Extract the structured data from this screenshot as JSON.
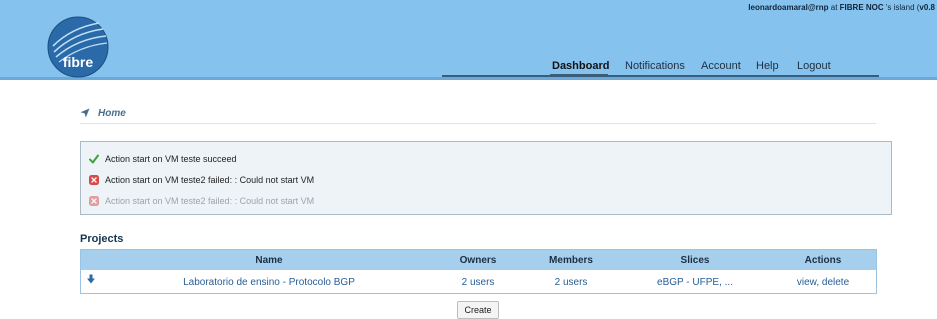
{
  "header": {
    "user": "leonardoamaral@rnp",
    "at_text": " at ",
    "island": "FIBRE NOC",
    "island_suffix": " 's island (",
    "version": "v0.8",
    "logo_text": "fibre",
    "colors": {
      "bar": "#86c2ee",
      "logo": "#2a6aa8"
    }
  },
  "nav": {
    "items": [
      {
        "label": "Dashboard",
        "active": true
      },
      {
        "label": "Notifications"
      },
      {
        "label": "Account"
      },
      {
        "label": "Help"
      },
      {
        "label": "Logout"
      }
    ]
  },
  "breadcrumb": {
    "label": "Home",
    "icon": "location-arrow-icon"
  },
  "messages": [
    {
      "icon": "check-icon",
      "text": "Action start on VM teste succeed"
    },
    {
      "icon": "error-icon",
      "text": "Action start on VM teste2 failed: : Could not start VM"
    },
    {
      "icon": "error-icon",
      "text": "Action start on VM teste2 failed: : Could not start VM",
      "faded": true
    }
  ],
  "projects": {
    "title": "Projects",
    "columns": [
      "Name",
      "Owners",
      "Members",
      "Slices",
      "Actions"
    ],
    "rows": [
      {
        "name": "Laboratorio de ensino - Protocolo BGP",
        "owners": "2 users",
        "members": "2 users",
        "slices": "eBGP - UFPE, ...",
        "action_view": "view",
        "action_sep": ", ",
        "action_delete": "delete"
      }
    ],
    "create_label": "Create"
  }
}
